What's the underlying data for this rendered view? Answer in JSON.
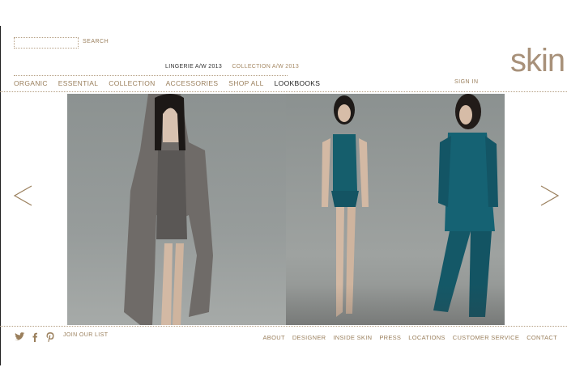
{
  "search": {
    "button_label": "SEARCH",
    "placeholder": ""
  },
  "sub_nav": {
    "active": "LINGERIE A/W 2013",
    "inactive": "COLLECTION A/W 2013"
  },
  "main_nav": {
    "items": [
      "ORGANIC",
      "ESSENTIAL",
      "COLLECTION",
      "ACCESSORIES",
      "SHOP ALL",
      "LOOKBOOKS"
    ]
  },
  "account": {
    "signin_label": "SIGN IN"
  },
  "brand": {
    "logo_text": "skin",
    "accent_color": "#a8917a",
    "link_color": "#9a7f5c"
  },
  "carousel": {
    "prev_icon": "chevron-left-icon",
    "next_icon": "chevron-right-icon"
  },
  "footer": {
    "social_icons": [
      "twitter-icon",
      "facebook-icon",
      "pinterest-icon"
    ],
    "join_label": "JOIN OUR LIST",
    "links": [
      "ABOUT",
      "DESIGNER",
      "INSIDE SKIN",
      "PRESS",
      "LOCATIONS",
      "CUSTOMER SERVICE",
      "CONTACT"
    ]
  }
}
